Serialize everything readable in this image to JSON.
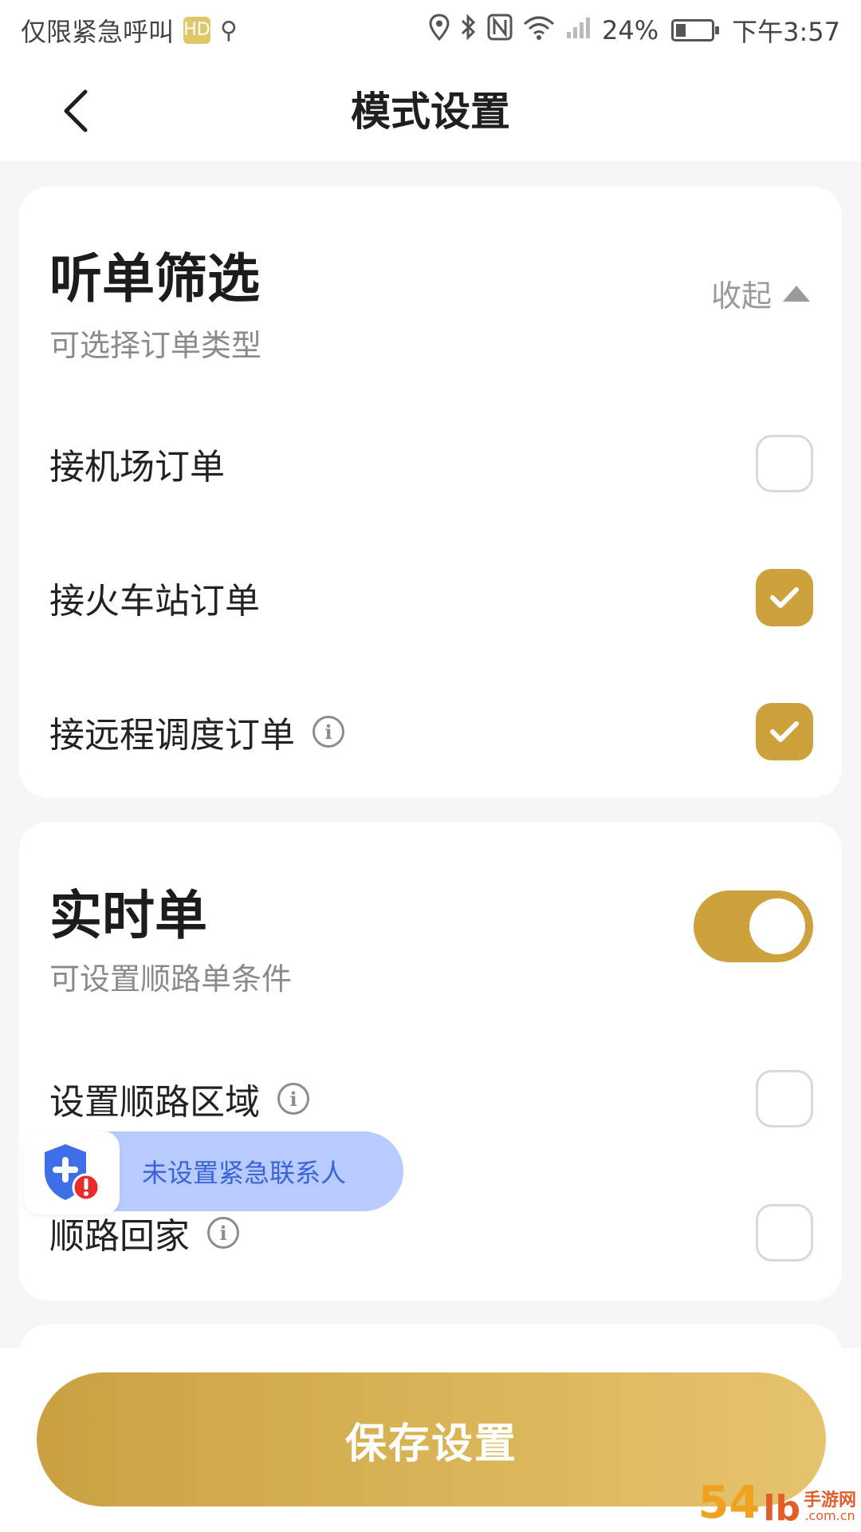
{
  "status_bar": {
    "carrier": "仅限紧急呼叫",
    "badge": "HD",
    "battery": "24%",
    "time": "下午3:57"
  },
  "navbar": {
    "title": "模式设置"
  },
  "filter_section": {
    "title": "听单筛选",
    "subtitle": "可选择订单类型",
    "collapse_label": "收起",
    "items": [
      {
        "label": "接机场订单",
        "checked": false
      },
      {
        "label": "接火车站订单",
        "checked": true
      },
      {
        "label": "接远程调度订单",
        "checked": true
      }
    ]
  },
  "realtime_section": {
    "title": "实时单",
    "subtitle": "可设置顺路单条件",
    "toggle_on": true,
    "items": [
      {
        "label": "设置顺路区域",
        "checked": false
      },
      {
        "label": "顺路回家",
        "checked": false
      }
    ]
  },
  "toast": {
    "text": "未设置紧急联系人"
  },
  "save_button": {
    "label": "保存设置"
  },
  "watermark": {
    "brand": "54",
    "mark": "lb",
    "line1": "手游网",
    "line2": ".com.cn"
  },
  "colors": {
    "accent": "#cda13c",
    "toast_bg": "#b8cbff",
    "toast_text": "#3a63d6"
  }
}
